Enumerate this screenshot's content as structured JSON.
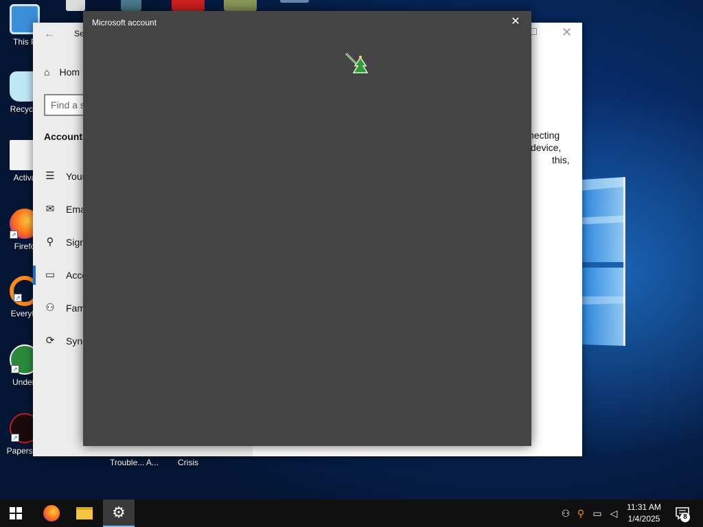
{
  "desktop": {
    "icons": [
      {
        "label": "This P",
        "icon": "this-pc-icon"
      },
      {
        "label": "Recycle",
        "icon": "recycle-bin-icon"
      },
      {
        "label": "Activa",
        "icon": "folder-icon"
      },
      {
        "label": "Firefo",
        "icon": "firefox-icon"
      },
      {
        "label": "Everyth",
        "icon": "everything-search-icon"
      },
      {
        "label": "Undert",
        "icon": "undertale-icon"
      },
      {
        "label": "Papers, P",
        "icon": "papers-please-icon"
      }
    ],
    "bottom_labels": [
      "Trouble... A...",
      "Crisis"
    ]
  },
  "settings_window": {
    "title": "Se",
    "home": "Hom",
    "search_placeholder": "Find a s",
    "section": "Accounts",
    "nav": [
      {
        "label": "Your",
        "icon": "person-info-icon"
      },
      {
        "label": "Ema",
        "icon": "mail-icon"
      },
      {
        "label": "Sign",
        "icon": "key-icon"
      },
      {
        "label": "Acce",
        "icon": "briefcase-icon"
      },
      {
        "label": "Fam",
        "icon": "add-person-icon"
      },
      {
        "label": "Sync",
        "icon": "sync-icon"
      }
    ],
    "right_text": [
      "necting",
      "device,",
      "this,"
    ]
  },
  "dialog": {
    "title": "Microsoft account",
    "close_symbol": "✕"
  },
  "taskbar": {
    "time": "11:31 AM",
    "date": "1/4/2025",
    "notification_count": "8"
  },
  "colors": {
    "accent": "#1f6fd1",
    "dialog_bg": "#444444",
    "taskbar_bg": "#101010"
  }
}
